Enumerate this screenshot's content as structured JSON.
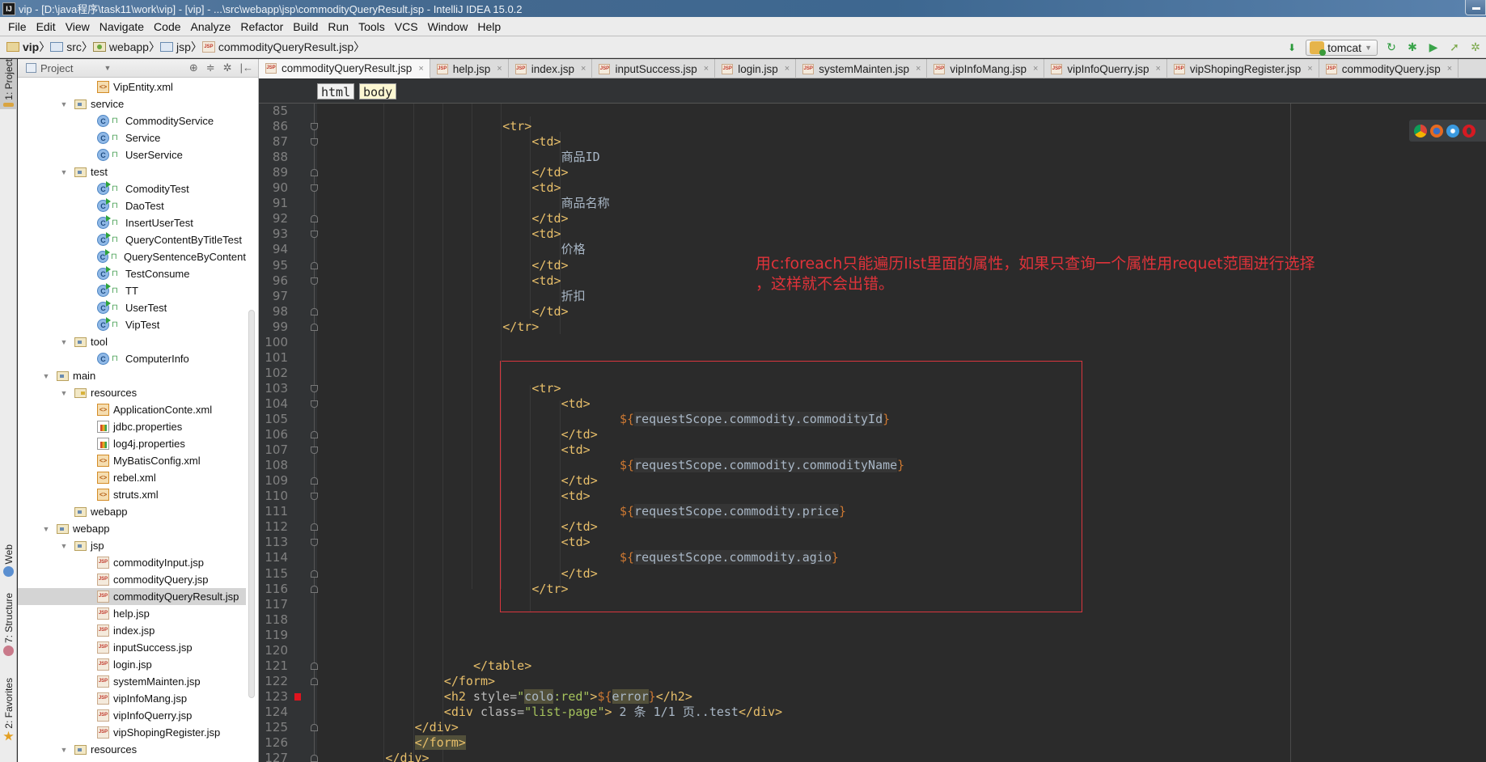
{
  "window": {
    "title": "vip - [D:\\java程序\\task11\\work\\vip] - [vip] - ...\\src\\webapp\\jsp\\commodityQueryResult.jsp - IntelliJ IDEA 15.0.2",
    "app_icon": "IJ"
  },
  "menu": [
    "File",
    "Edit",
    "View",
    "Navigate",
    "Code",
    "Analyze",
    "Refactor",
    "Build",
    "Run",
    "Tools",
    "VCS",
    "Window",
    "Help"
  ],
  "navbar": {
    "crumbs": [
      {
        "label": "vip",
        "icon": "project-folder-icon"
      },
      {
        "label": "src",
        "icon": "folder-icon"
      },
      {
        "label": "webapp",
        "icon": "web-folder-icon"
      },
      {
        "label": "jsp",
        "icon": "folder-icon"
      },
      {
        "label": "commodityQueryResult.jsp",
        "icon": "jsp-file-icon"
      }
    ],
    "run_config": "tomcat"
  },
  "left_strip": {
    "project": "1: Project",
    "web": "Web",
    "structure": "7: Structure",
    "favorites": "2: Favorites"
  },
  "project_panel": {
    "title": "Project",
    "tree": [
      {
        "label": "VipEntity.xml",
        "type": "xml",
        "depth": 3
      },
      {
        "label": "service",
        "type": "folder",
        "depth": 2,
        "expanded": true
      },
      {
        "label": "CommodityService",
        "type": "class",
        "depth": 3
      },
      {
        "label": "Service",
        "type": "class",
        "depth": 3
      },
      {
        "label": "UserService",
        "type": "class",
        "depth": 3
      },
      {
        "label": "test",
        "type": "folder",
        "depth": 2,
        "expanded": true
      },
      {
        "label": "ComodityTest",
        "type": "test",
        "depth": 3
      },
      {
        "label": "DaoTest",
        "type": "test",
        "depth": 3
      },
      {
        "label": "InsertUserTest",
        "type": "test",
        "depth": 3
      },
      {
        "label": "QueryContentByTitleTest",
        "type": "test",
        "depth": 3
      },
      {
        "label": "QuerySentenceByContent",
        "type": "test",
        "depth": 3
      },
      {
        "label": "TestConsume",
        "type": "test",
        "depth": 3
      },
      {
        "label": "TT",
        "type": "test",
        "depth": 3
      },
      {
        "label": "UserTest",
        "type": "test",
        "depth": 3
      },
      {
        "label": "VipTest",
        "type": "test",
        "depth": 3
      },
      {
        "label": "tool",
        "type": "folder",
        "depth": 2,
        "expanded": true
      },
      {
        "label": "ComputerInfo",
        "type": "class",
        "depth": 3
      },
      {
        "label": "main",
        "type": "folder",
        "depth": 1,
        "expanded": true
      },
      {
        "label": "resources",
        "type": "res-folder",
        "depth": 2,
        "expanded": true
      },
      {
        "label": "ApplicationConte.xml",
        "type": "xml",
        "depth": 3
      },
      {
        "label": "jdbc.properties",
        "type": "prop",
        "depth": 3
      },
      {
        "label": "log4j.properties",
        "type": "prop",
        "depth": 3
      },
      {
        "label": "MyBatisConfig.xml",
        "type": "xml",
        "depth": 3
      },
      {
        "label": "rebel.xml",
        "type": "xml",
        "depth": 3
      },
      {
        "label": "struts.xml",
        "type": "xml",
        "depth": 3
      },
      {
        "label": "webapp",
        "type": "folder",
        "depth": 2
      },
      {
        "label": "webapp",
        "type": "folder",
        "depth": 1,
        "expanded": true
      },
      {
        "label": "jsp",
        "type": "folder",
        "depth": 2,
        "expanded": true
      },
      {
        "label": "commodityInput.jsp",
        "type": "jsp",
        "depth": 3
      },
      {
        "label": "commodityQuery.jsp",
        "type": "jsp",
        "depth": 3
      },
      {
        "label": "commodityQueryResult.jsp",
        "type": "jsp",
        "depth": 3,
        "selected": true
      },
      {
        "label": "help.jsp",
        "type": "jsp",
        "depth": 3
      },
      {
        "label": "index.jsp",
        "type": "jsp",
        "depth": 3
      },
      {
        "label": "inputSuccess.jsp",
        "type": "jsp",
        "depth": 3
      },
      {
        "label": "login.jsp",
        "type": "jsp",
        "depth": 3
      },
      {
        "label": "systemMainten.jsp",
        "type": "jsp",
        "depth": 3
      },
      {
        "label": "vipInfoMang.jsp",
        "type": "jsp",
        "depth": 3
      },
      {
        "label": "vipInfoQuerry.jsp",
        "type": "jsp",
        "depth": 3
      },
      {
        "label": "vipShopingRegister.jsp",
        "type": "jsp",
        "depth": 3
      },
      {
        "label": "resources",
        "type": "folder",
        "depth": 2,
        "expanded": true
      }
    ]
  },
  "editor": {
    "tabs": [
      {
        "label": "commodityQueryResult.jsp",
        "active": true
      },
      {
        "label": "help.jsp"
      },
      {
        "label": "index.jsp"
      },
      {
        "label": "inputSuccess.jsp"
      },
      {
        "label": "login.jsp"
      },
      {
        "label": "systemMainten.jsp"
      },
      {
        "label": "vipInfoMang.jsp"
      },
      {
        "label": "vipInfoQuerry.jsp"
      },
      {
        "label": "vipShopingRegister.jsp"
      },
      {
        "label": "commodityQuery.jsp"
      }
    ],
    "tag_breadcrumbs": [
      "html",
      "body"
    ],
    "annotation": {
      "line1": "用c:foreach只能遍历list里面的属性，如果只查询一个属性用requet范围进行选择",
      "line2": "，这样就不会出错。"
    },
    "lines": [
      {
        "n": 85,
        "indent": 0,
        "parts": []
      },
      {
        "n": 86,
        "indent": 12,
        "fold": "open",
        "parts": [
          [
            "tg",
            "<tr>"
          ]
        ]
      },
      {
        "n": 87,
        "indent": 14,
        "fold": "open",
        "parts": [
          [
            "tg",
            "<td>"
          ]
        ]
      },
      {
        "n": 88,
        "indent": 16,
        "parts": [
          [
            "cn",
            "商品ID"
          ]
        ]
      },
      {
        "n": 89,
        "indent": 14,
        "fold": "close",
        "parts": [
          [
            "tg",
            "</td>"
          ]
        ]
      },
      {
        "n": 90,
        "indent": 14,
        "fold": "open",
        "parts": [
          [
            "tg",
            "<td>"
          ]
        ]
      },
      {
        "n": 91,
        "indent": 16,
        "parts": [
          [
            "cn",
            "商品名称"
          ]
        ]
      },
      {
        "n": 92,
        "indent": 14,
        "fold": "close",
        "parts": [
          [
            "tg",
            "</td>"
          ]
        ]
      },
      {
        "n": 93,
        "indent": 14,
        "fold": "open",
        "parts": [
          [
            "tg",
            "<td>"
          ]
        ]
      },
      {
        "n": 94,
        "indent": 16,
        "parts": [
          [
            "cn",
            "价格"
          ]
        ]
      },
      {
        "n": 95,
        "indent": 14,
        "fold": "close",
        "parts": [
          [
            "tg",
            "</td>"
          ]
        ]
      },
      {
        "n": 96,
        "indent": 14,
        "fold": "open",
        "parts": [
          [
            "tg",
            "<td>"
          ]
        ]
      },
      {
        "n": 97,
        "indent": 16,
        "parts": [
          [
            "cn",
            "折扣"
          ]
        ]
      },
      {
        "n": 98,
        "indent": 14,
        "fold": "close",
        "parts": [
          [
            "tg",
            "</td>"
          ]
        ]
      },
      {
        "n": 99,
        "indent": 12,
        "fold": "close",
        "parts": [
          [
            "tg",
            "</tr>"
          ]
        ]
      },
      {
        "n": 100,
        "indent": 0,
        "parts": []
      },
      {
        "n": 101,
        "indent": 0,
        "parts": []
      },
      {
        "n": 102,
        "indent": 0,
        "parts": []
      },
      {
        "n": 103,
        "indent": 14,
        "fold": "open",
        "parts": [
          [
            "tg",
            "<tr>"
          ]
        ]
      },
      {
        "n": 104,
        "indent": 16,
        "fold": "open",
        "parts": [
          [
            "tg",
            "<td>"
          ]
        ]
      },
      {
        "n": 105,
        "indent": 20,
        "parts": [
          [
            "el",
            "${"
          ],
          [
            "elbody",
            "requestScope.commodity.commodityId"
          ],
          [
            "el",
            "}"
          ]
        ]
      },
      {
        "n": 106,
        "indent": 16,
        "fold": "close",
        "parts": [
          [
            "tg",
            "</td>"
          ]
        ]
      },
      {
        "n": 107,
        "indent": 16,
        "fold": "open",
        "parts": [
          [
            "tg",
            "<td>"
          ]
        ]
      },
      {
        "n": 108,
        "indent": 20,
        "parts": [
          [
            "el",
            "${"
          ],
          [
            "elbody",
            "requestScope.commodity.commodityName"
          ],
          [
            "el",
            "}"
          ]
        ]
      },
      {
        "n": 109,
        "indent": 16,
        "fold": "close",
        "parts": [
          [
            "tg",
            "</td>"
          ]
        ]
      },
      {
        "n": 110,
        "indent": 16,
        "fold": "open",
        "parts": [
          [
            "tg",
            "<td>"
          ]
        ]
      },
      {
        "n": 111,
        "indent": 20,
        "parts": [
          [
            "el",
            "${"
          ],
          [
            "elbody",
            "requestScope.commodity.price"
          ],
          [
            "el",
            "}"
          ]
        ]
      },
      {
        "n": 112,
        "indent": 16,
        "fold": "close",
        "parts": [
          [
            "tg",
            "</td>"
          ]
        ]
      },
      {
        "n": 113,
        "indent": 16,
        "fold": "open",
        "parts": [
          [
            "tg",
            "<td>"
          ]
        ]
      },
      {
        "n": 114,
        "indent": 20,
        "parts": [
          [
            "el",
            "${"
          ],
          [
            "elbody",
            "requestScope.commodity.agio"
          ],
          [
            "el",
            "}"
          ]
        ]
      },
      {
        "n": 115,
        "indent": 16,
        "fold": "close",
        "parts": [
          [
            "tg",
            "</td>"
          ]
        ]
      },
      {
        "n": 116,
        "indent": 14,
        "fold": "close",
        "parts": [
          [
            "tg",
            "</tr>"
          ]
        ]
      },
      {
        "n": 117,
        "indent": 0,
        "parts": []
      },
      {
        "n": 118,
        "indent": 0,
        "parts": []
      },
      {
        "n": 119,
        "indent": 0,
        "parts": []
      },
      {
        "n": 120,
        "indent": 0,
        "parts": []
      },
      {
        "n": 121,
        "indent": 10,
        "fold": "close",
        "parts": [
          [
            "tg",
            "</table>"
          ]
        ]
      },
      {
        "n": 122,
        "indent": 8,
        "fold": "close",
        "parts": [
          [
            "tg",
            "</form>"
          ]
        ]
      },
      {
        "n": 123,
        "indent": 8,
        "breakpoint": true,
        "parts": [
          [
            "tg",
            "<h2 "
          ],
          [
            "at",
            "style="
          ],
          [
            "av",
            "\""
          ],
          [
            "hl",
            "colo"
          ],
          [
            "av",
            ":red\""
          ],
          [
            "tg",
            ">"
          ],
          [
            "el",
            "${"
          ],
          [
            "hl",
            "error"
          ],
          [
            "el",
            "}"
          ],
          [
            "tg",
            "</h2>"
          ]
        ]
      },
      {
        "n": 124,
        "indent": 8,
        "parts": [
          [
            "tg",
            "<div "
          ],
          [
            "at",
            "class="
          ],
          [
            "av",
            "\"list-page\""
          ],
          [
            "tg",
            ">"
          ],
          [
            "cn",
            " 2 条 1/1 页..test"
          ],
          [
            "tg",
            "</div>"
          ]
        ]
      },
      {
        "n": 125,
        "indent": 6,
        "fold": "close",
        "parts": [
          [
            "tg",
            "</div>"
          ]
        ]
      },
      {
        "n": 126,
        "indent": 6,
        "parts": [
          [
            "hltg",
            "</form>"
          ]
        ]
      },
      {
        "n": 127,
        "indent": 4,
        "fold": "close",
        "parts": [
          [
            "tg",
            "</div>"
          ]
        ]
      }
    ]
  }
}
